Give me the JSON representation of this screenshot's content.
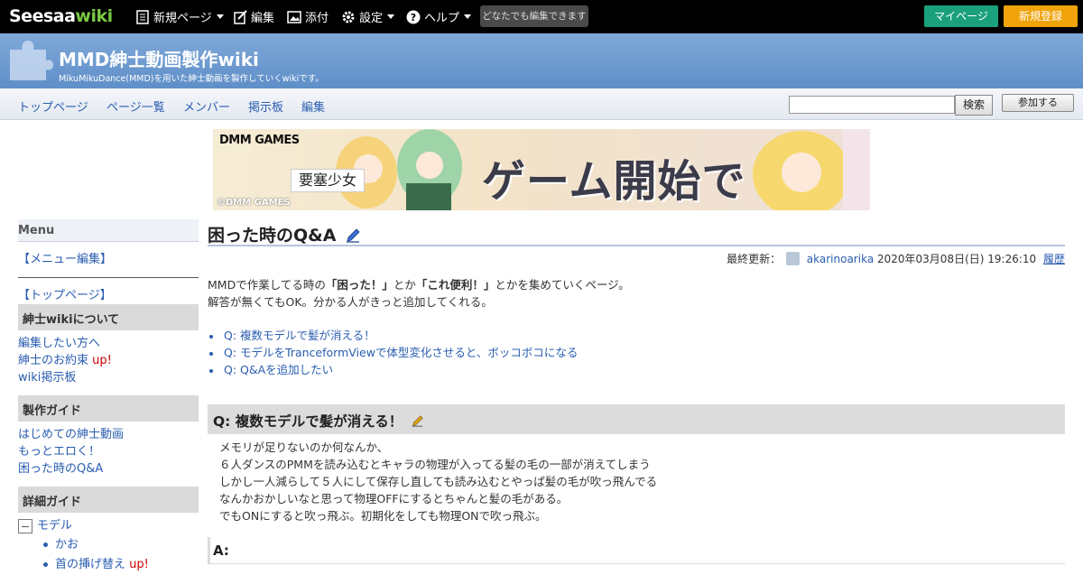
{
  "topbar": {
    "logo_main": "Seesaa",
    "logo_accent": "wiki",
    "new_page": "新規ページ",
    "edit": "編集",
    "attach": "添付",
    "settings": "設定",
    "help": "ヘルプ",
    "edit_notice": "どなたでも編集できます",
    "mypage": "マイページ",
    "register": "新規登録"
  },
  "header": {
    "title": "MMD紳士動画製作wiki",
    "description": "MikuMikuDance(MMD)を用いた紳士動画を製作していくwikiです。"
  },
  "nav": {
    "items": [
      "トップページ",
      "ページ一覧",
      "メンバー",
      "掲示板",
      "編集"
    ],
    "search_button": "検索",
    "join_button": "参加する"
  },
  "banner": {
    "brand": "DMM GAMES",
    "game_title": "要塞少女",
    "cta": "ゲーム開始で",
    "copyright": "©DMM GAMES"
  },
  "sidebar": {
    "menu_title": "Menu",
    "menu_edit": "【メニュー編集】",
    "top_link": "【トップページ】",
    "sections": [
      {
        "title": "紳士wikiについて",
        "links": [
          "編集したい方へ",
          "紳士のお約束",
          "wiki掲示板"
        ]
      },
      {
        "title": "製作ガイド",
        "links": [
          "はじめての紳士動画",
          "もっとエロく！",
          "困った時のQ&A"
        ]
      },
      {
        "title": "詳細ガイド"
      }
    ],
    "up_label": "up!",
    "tree_root": "モデル",
    "tree_children": [
      "かお",
      "首の挿げ替え"
    ]
  },
  "main": {
    "title": "困った時のQ&A",
    "meta_label": "最終更新：",
    "meta_user": "akarinoarika",
    "meta_date": "2020年03月08日(日) 19:26:10",
    "meta_history": "履歴",
    "intro_1a": "MMDで作業してる時の",
    "intro_1b": "「困った！」",
    "intro_1c": "とか",
    "intro_1d": "「これ便利！」",
    "intro_1e": "とかを集めていくページ。",
    "intro_2": "解答が無くてもOK。分かる人がきっと追加してくれる。",
    "toc": [
      "Q: 複数モデルで髪が消える！",
      "Q: モデルをTranceformViewで体型変化させると、ボッコボコになる",
      "Q: Q&Aを追加したい"
    ],
    "section_title": "Q: 複数モデルで髪が消える！",
    "body_lines": [
      "メモリが足りないのか何なんか、",
      "６人ダンスのPMMを読み込むとキャラの物理が入ってる髪の毛の一部が消えてしまう",
      "しかし一人減らして５人にして保存し直しても読み込むとやっぱ髪の毛が吹っ飛んでる",
      "なんかおかしいなと思って物理OFFにするとちゃんと髪の毛がある。",
      "でもONにすると吹っ飛ぶ。初期化をしても物理ONで吹っ飛ぶ。"
    ],
    "answer_title": "A:"
  }
}
